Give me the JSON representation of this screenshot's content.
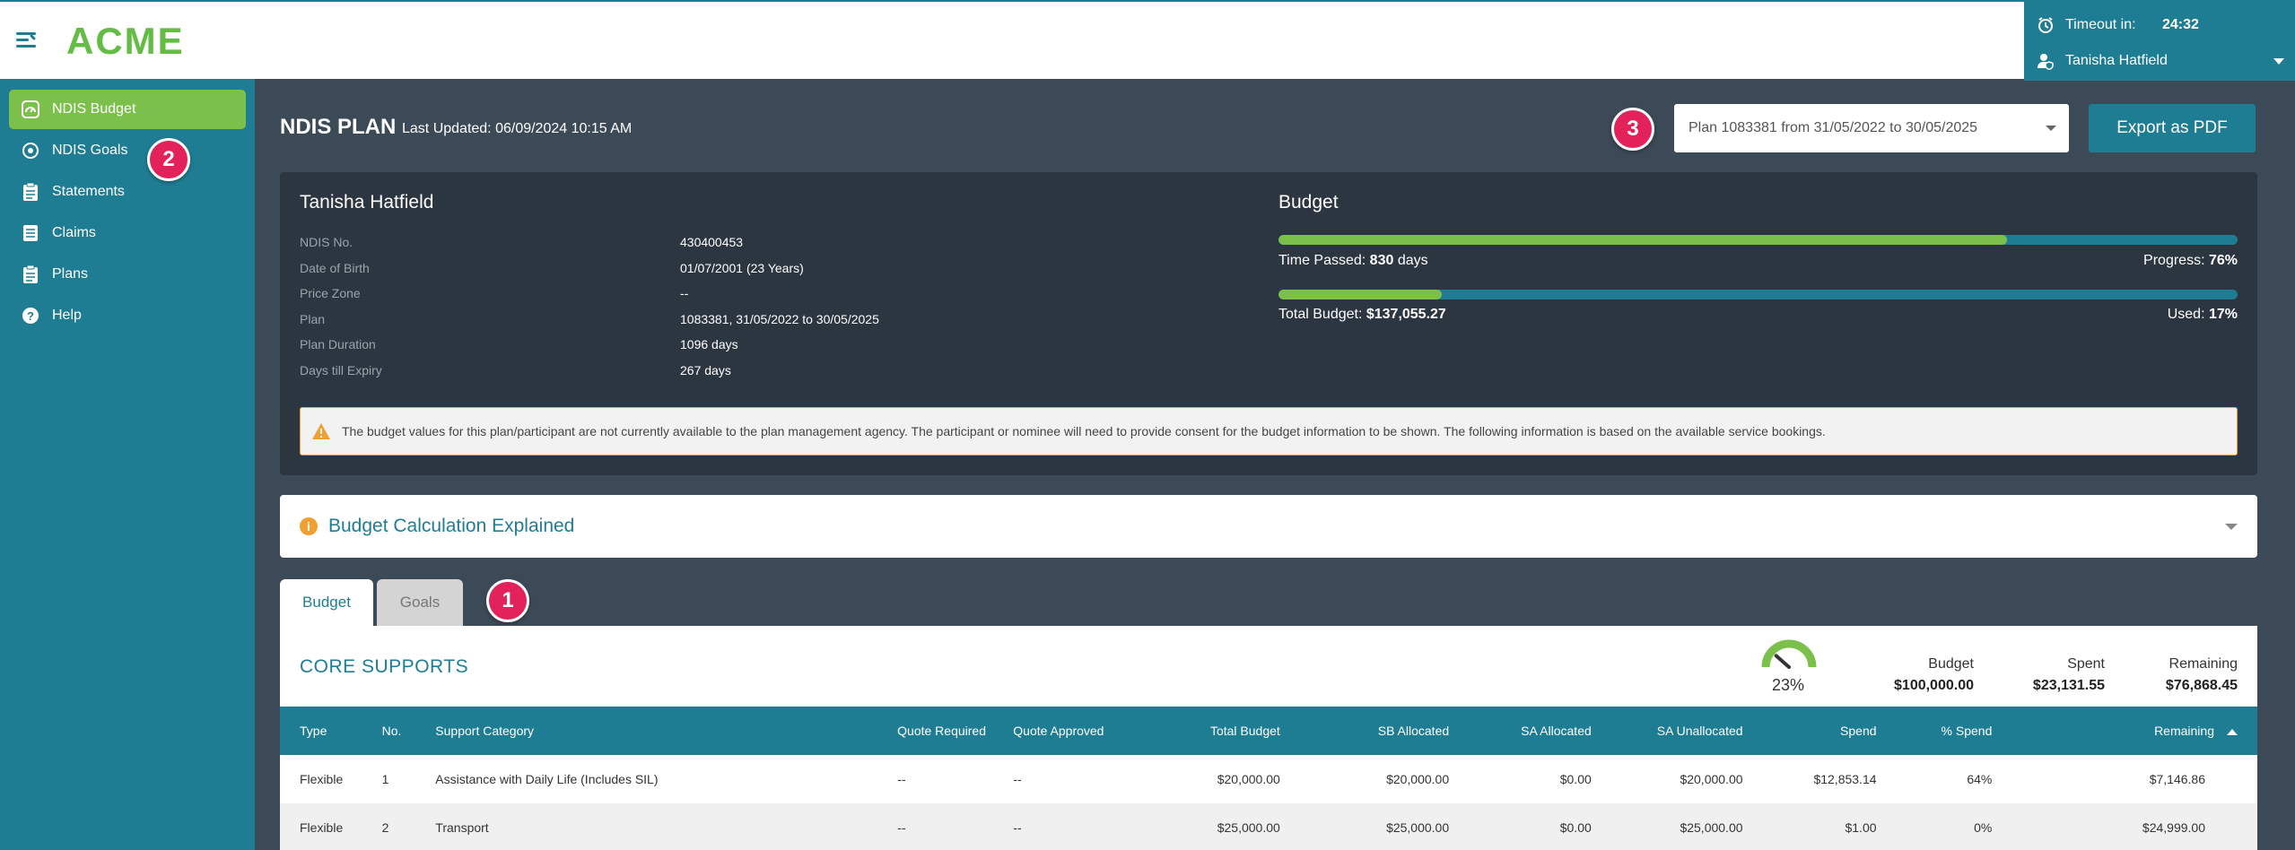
{
  "app": {
    "logo": "ACME"
  },
  "session": {
    "timeout_label": "Timeout in:",
    "timeout_value": "24:32",
    "user_name": "Tanisha Hatfield"
  },
  "sidebar": {
    "items": [
      {
        "label": "NDIS Budget",
        "icon": "gauge-icon",
        "active": true
      },
      {
        "label": "NDIS Goals",
        "icon": "target-icon"
      },
      {
        "label": "Statements",
        "icon": "clipboard-icon"
      },
      {
        "label": "Claims",
        "icon": "list-icon"
      },
      {
        "label": "Plans",
        "icon": "clipboard-icon"
      },
      {
        "label": "Help",
        "icon": "help-icon"
      }
    ]
  },
  "badges": {
    "one": "1",
    "two": "2",
    "three": "3"
  },
  "header": {
    "title": "NDIS PLAN",
    "last_updated": "Last Updated: 06/09/2024 10:15 AM",
    "plan_select": "Plan 1083381 from 31/05/2022 to 30/05/2025",
    "export_label": "Export as PDF"
  },
  "participant": {
    "name": "Tanisha Hatfield",
    "fields": [
      {
        "label": "NDIS No.",
        "value": "430400453"
      },
      {
        "label": "Date of Birth",
        "value": "01/07/2001 (23 Years)"
      },
      {
        "label": "Price Zone",
        "value": "--"
      },
      {
        "label": "Plan",
        "value": "1083381, 31/05/2022 to 30/05/2025"
      },
      {
        "label": "Plan Duration",
        "value": "1096 days"
      },
      {
        "label": "Days till Expiry",
        "value": "267 days"
      }
    ]
  },
  "budget": {
    "title": "Budget",
    "time_passed_label": "Time Passed: ",
    "time_passed_days": "830",
    "time_passed_unit": " days",
    "progress_label": "Progress: ",
    "progress_value": "76%",
    "progress_fraction": 0.76,
    "total_label": "Total Budget: ",
    "total_value": "$137,055.27",
    "used_label": "Used: ",
    "used_value": "17%",
    "used_fraction": 0.17
  },
  "warning": "The budget values for this plan/participant are not currently available to the plan management agency. The participant or nominee will need to provide consent for the budget information to be shown. The following information is based on the available service bookings.",
  "accordion": {
    "title": "Budget Calculation Explained"
  },
  "tabs": [
    {
      "label": "Budget",
      "active": true
    },
    {
      "label": "Goals"
    }
  ],
  "core_supports": {
    "title": "CORE SUPPORTS",
    "gauge_pct": "23%",
    "gauge_fraction": 0.23,
    "summary": [
      {
        "label": "Budget",
        "value": "$100,000.00"
      },
      {
        "label": "Spent",
        "value": "$23,131.55"
      },
      {
        "label": "Remaining",
        "value": "$76,868.45"
      }
    ],
    "columns": [
      "Type",
      "No.",
      "Support Category",
      "Quote Required",
      "Quote Approved",
      "Total Budget",
      "SB Allocated",
      "SA Allocated",
      "SA Unallocated",
      "Spend",
      "% Spend",
      "Remaining"
    ],
    "rows": [
      [
        "Flexible",
        "1",
        "Assistance with Daily Life (Includes SIL)",
        "--",
        "--",
        "$20,000.00",
        "$20,000.00",
        "$0.00",
        "$20,000.00",
        "$12,853.14",
        "64%",
        "$7,146.86"
      ],
      [
        "Flexible",
        "2",
        "Transport",
        "--",
        "--",
        "$25,000.00",
        "$25,000.00",
        "$0.00",
        "$25,000.00",
        "$1.00",
        "0%",
        "$24,999.00"
      ]
    ]
  }
}
